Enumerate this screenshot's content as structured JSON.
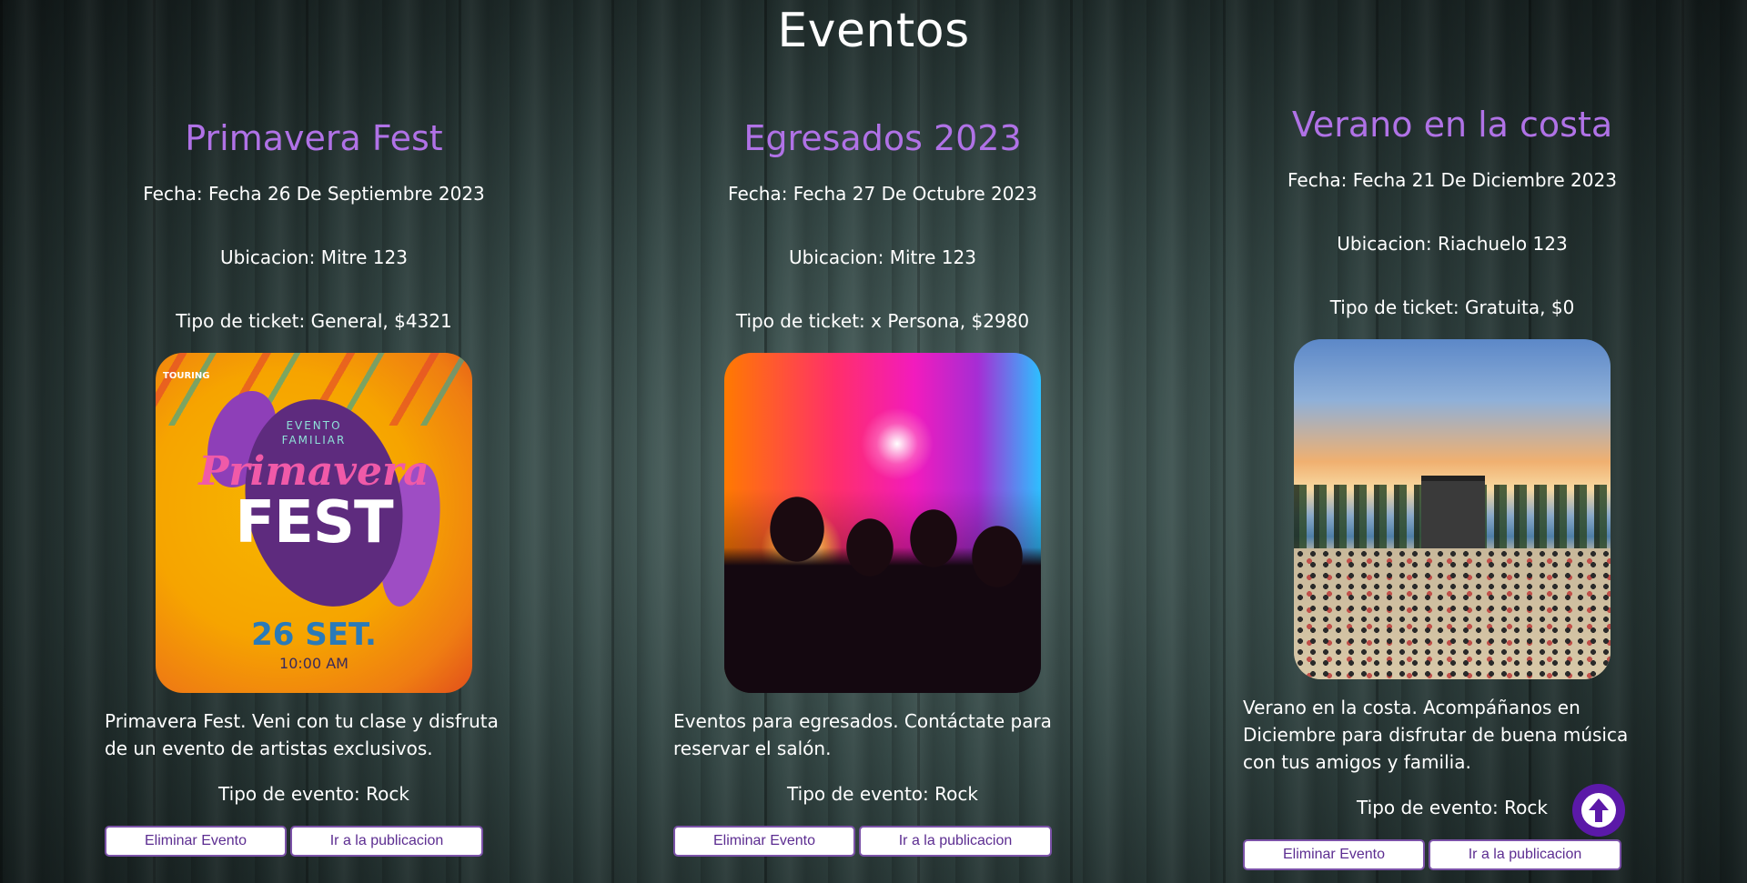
{
  "page": {
    "title": "Eventos"
  },
  "events": [
    {
      "title": "Primavera Fest",
      "fecha": "Fecha: Fecha 26 De Septiembre 2023",
      "ubicacion": "Ubicacion: Mitre 123",
      "ticket": "Tipo de ticket: General, $4321",
      "image": {
        "logo": "TOURING",
        "line1": "EVENTO",
        "line2": "FAMILIAR",
        "script": "Primavera",
        "fest": "FEST",
        "date": "26 SET.",
        "time": "10:00 AM"
      },
      "description": "Primavera Fest. Veni con tu clase y disfruta de un evento de artistas exclusivos.",
      "tipo_evento": "Tipo de evento: Rock",
      "delete_label": "Eliminar Evento",
      "go_label": "Ir a la publicacion"
    },
    {
      "title": "Egresados 2023",
      "fecha": "Fecha: Fecha 27 De Octubre 2023",
      "ubicacion": "Ubicacion: Mitre 123",
      "ticket": "Tipo de ticket: x Persona, $2980",
      "description": "Eventos para egresados. Contáctate para reservar el salón.",
      "tipo_evento": "Tipo de evento: Rock",
      "delete_label": "Eliminar Evento",
      "go_label": "Ir a la publicacion"
    },
    {
      "title": "Verano en la costa",
      "fecha": "Fecha: Fecha 21 De Diciembre 2023",
      "ubicacion": "Ubicacion: Riachuelo 123",
      "ticket": "Tipo de ticket: Gratuita, $0",
      "description": "Verano en la costa. Acompáñanos en Diciembre para disfrutar de buena música con tus amigos y familia.",
      "tipo_evento": "Tipo de evento: Rock",
      "delete_label": "Eliminar Evento",
      "go_label": "Ir a la publicacion"
    }
  ],
  "scroll_top": {
    "icon": "arrow-up-icon",
    "color": "#5b19a8"
  },
  "colors": {
    "title_accent": "#b072e6",
    "button_text": "#5c2d91",
    "button_border": "#7b52a8"
  }
}
